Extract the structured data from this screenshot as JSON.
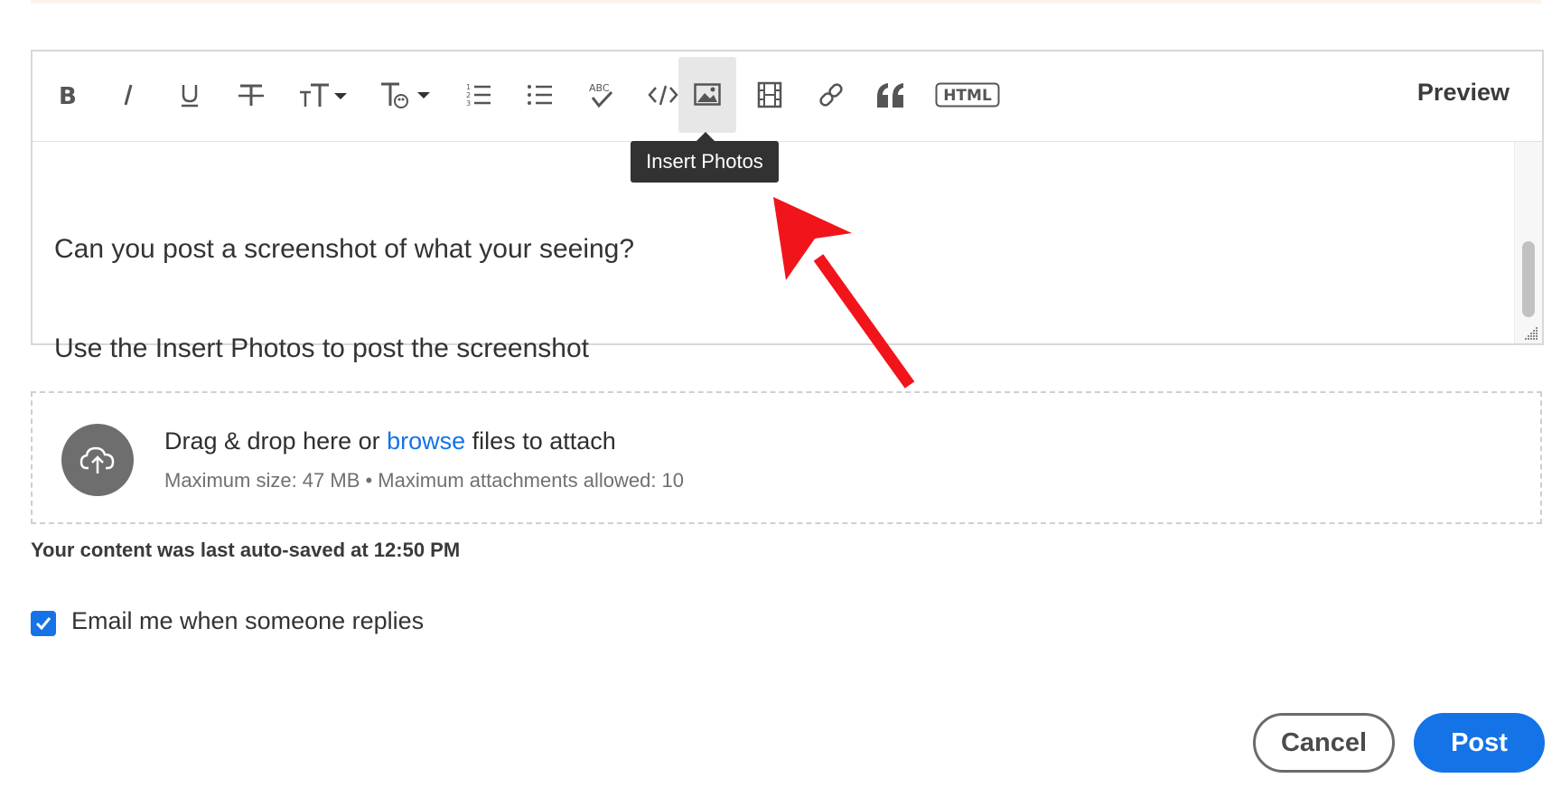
{
  "editor": {
    "toolbar": {
      "tools": [
        {
          "name": "bold-icon"
        },
        {
          "name": "italic-icon"
        },
        {
          "name": "underline-icon"
        },
        {
          "name": "strikethrough-icon"
        },
        {
          "name": "font-size-icon"
        },
        {
          "name": "text-color-icon"
        },
        {
          "name": "numbered-list-icon"
        },
        {
          "name": "bulleted-list-icon"
        },
        {
          "name": "spellcheck-icon"
        },
        {
          "name": "code-icon"
        },
        {
          "name": "insert-photo-icon"
        },
        {
          "name": "insert-video-icon"
        },
        {
          "name": "link-icon"
        },
        {
          "name": "quote-icon"
        },
        {
          "name": "html-icon"
        }
      ],
      "preview_label": "Preview"
    },
    "tooltip": "Insert Photos",
    "content": {
      "line1": "Can you post a screenshot of what your seeing?",
      "line2": "Use the Insert Photos to post the screenshot"
    }
  },
  "annotation": {
    "arrow_color": "#f2141b"
  },
  "dropzone": {
    "title_before": "Drag & drop here or ",
    "browse_link": "browse",
    "title_after": " files to attach",
    "subtitle": "Maximum size: 47 MB • Maximum attachments allowed: 10"
  },
  "autosave_text": "Your content was last auto-saved at 12:50 PM",
  "email_checkbox": {
    "label": "Email me when someone replies",
    "checked": true
  },
  "actions": {
    "cancel_label": "Cancel",
    "post_label": "Post"
  },
  "colors": {
    "accent": "#1473e6",
    "tooltip_bg": "#323232"
  }
}
